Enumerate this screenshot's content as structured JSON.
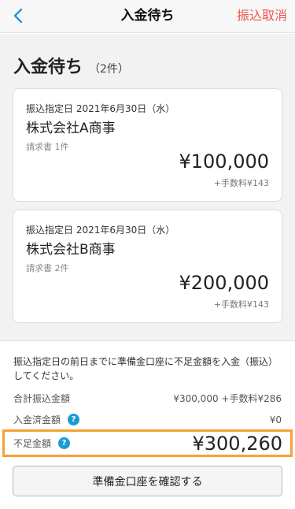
{
  "navbar": {
    "title": "入金待ち",
    "cancel_label": "振込取消"
  },
  "heading": {
    "title": "入金待ち",
    "count": "（2件）"
  },
  "cards": [
    {
      "date": "振込指定日 2021年6月30日（水）",
      "company": "株式会社A商事",
      "invoice": "請求書 1件",
      "amount": "¥100,000",
      "fee": "+手数料¥143"
    },
    {
      "date": "振込指定日 2021年6月30日（水）",
      "company": "株式会社B商事",
      "invoice": "請求書 2件",
      "amount": "¥200,000",
      "fee": "+手数料¥143"
    }
  ],
  "summary": {
    "notice": "振込指定日の前日までに準備金口座に不足金額を入金（振込）してください。",
    "total_label": "合計振込金額",
    "total_value": "¥300,000 +手数料¥286",
    "deposited_label": "入金済金額",
    "deposited_value": "¥0",
    "shortage_label": "不足金額",
    "shortage_value": "¥300,260",
    "help_glyph": "?",
    "confirm_label": "準備金口座を確認する"
  },
  "colors": {
    "accent_red": "#f0544f",
    "accent_blue": "#1a9bd8",
    "highlight_orange": "#f5a233"
  },
  "icons": {
    "back": "chevron-left-icon",
    "help": "question-mark-icon"
  }
}
